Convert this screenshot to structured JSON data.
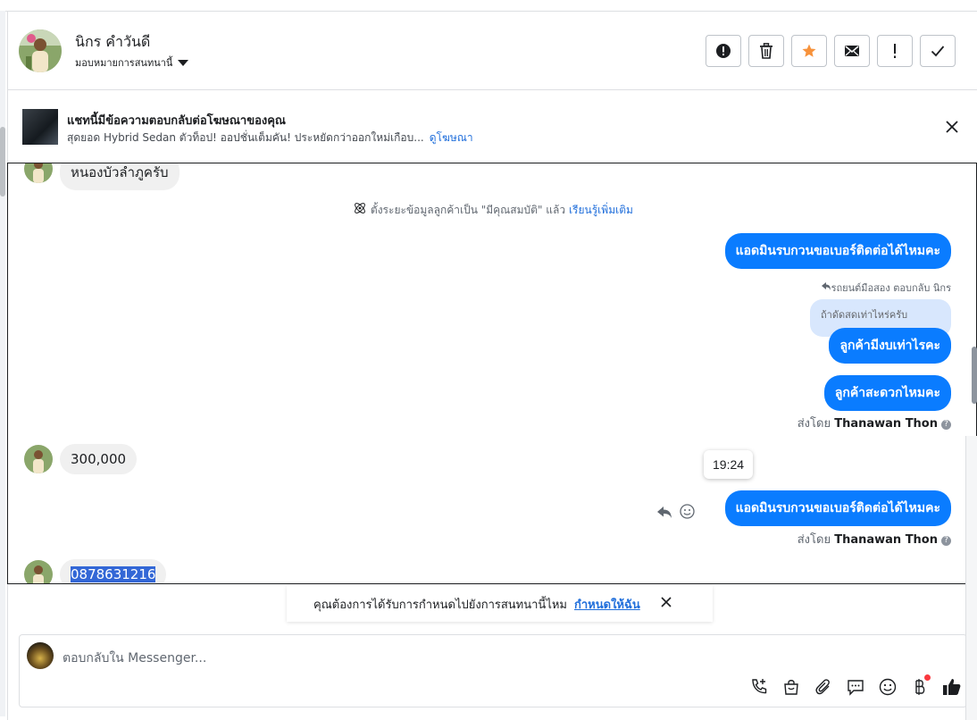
{
  "header": {
    "contact_name": "นิกร คำวันดี",
    "assign_label": "มอบหมายการสนทนานี้",
    "actions": [
      {
        "name": "report-spam-button",
        "icon": "alert-circle-icon"
      },
      {
        "name": "delete-button",
        "icon": "trash-icon"
      },
      {
        "name": "star-button",
        "icon": "star-icon"
      },
      {
        "name": "mark-unread-button",
        "icon": "envelope-icon"
      },
      {
        "name": "follow-up-button",
        "icon": "exclamation-icon"
      },
      {
        "name": "mark-done-button",
        "icon": "checkmark-icon"
      }
    ],
    "star_color": "#f7923b"
  },
  "ad_banner": {
    "title": "แชทนี้มีข้อความตอบกลับต่อโฆษณาของคุณ",
    "subtitle": "สุดยอด Hybrid Sedan ตัวท็อป! ออปชั่นเต็มคัน! ประหยัดกว่าออกใหม่เกือบ...",
    "link": "ดูโฆษณา"
  },
  "conversation": {
    "msg_in_1": "หนองบัวลำภูครับ",
    "system_note": "ตั้งระยะข้อมูลลูกค้าเป็น \"มีคุณสมบัติ\" แล้ว",
    "system_link": "เรียนรู้เพิ่มเติม",
    "msg_out_1": "แอดมินรบกวนขอเบอร์ติดต่อได้ไหมคะ",
    "reply_context": "รถยนต์มือสอง ตอบกลับ นิกร",
    "quoted_text": "ถ้าดัดสดเท่าไหร่ครับ",
    "msg_out_2": "ลูกค้ามีงบเท่าไรคะ",
    "msg_out_3": "ลูกค้าสะดวกไหมคะ",
    "sent_by_prefix": "ส่งโดย",
    "sent_by_name": "Thanawan Thon",
    "msg_in_2": "300,000",
    "tooltip_time": "19:24",
    "msg_out_4": "แอดมินรบกวนขอเบอร์ติดต่อได้ไหมคะ",
    "msg_in_3": "0878631216"
  },
  "suggestion": {
    "text": "คุณต้องการได้รับการกำหนดไปยังการสนทนานี้ไหม",
    "link": "กำหนดให้ฉัน"
  },
  "composer": {
    "placeholder": "ตอบกลับใน Messenger...",
    "tools": [
      "call-add-icon",
      "shopping-bag-icon",
      "paperclip-icon",
      "chat-bubble-icon",
      "emoji-icon",
      "baht-icon",
      "thumbs-up-icon"
    ]
  },
  "colors": {
    "accent": "#0a7cff",
    "link": "#216fdb"
  }
}
